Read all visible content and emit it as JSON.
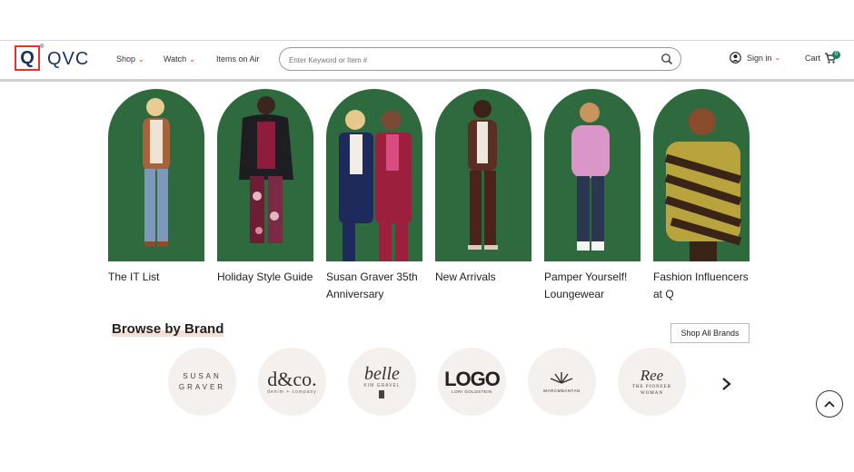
{
  "header": {
    "logo_mark": "Q",
    "logo_text": "QVC",
    "logo_tm": "®",
    "nav": [
      {
        "label": "Shop",
        "has_dropdown": true
      },
      {
        "label": "Watch",
        "has_dropdown": true
      },
      {
        "label": "Items on Air",
        "has_dropdown": false
      }
    ],
    "search": {
      "placeholder": "Enter Keyword or Item #",
      "icon": "search-icon"
    },
    "signin": {
      "label": "Sign in",
      "icon": "user-icon"
    },
    "cart": {
      "label": "Cart",
      "count": "0",
      "icon": "cart-icon"
    },
    "colors": {
      "brand": "#1b2f5e",
      "accent": "#e4332e"
    }
  },
  "categories": [
    {
      "label": "The IT List"
    },
    {
      "label": "Holiday Style Guide"
    },
    {
      "label": "Susan Graver 35th Anniversary"
    },
    {
      "label": "New Arrivals"
    },
    {
      "label": "Pamper Yourself! Loungewear"
    },
    {
      "label": "Fashion Influencers at Q"
    }
  ],
  "browse": {
    "title": "Browse by Brand",
    "shop_all": "Shop All Brands",
    "brands": [
      {
        "line1": "SUSAN",
        "line2": "GRAVER"
      },
      {
        "line1": "d&co.",
        "line2": "denim + company"
      },
      {
        "line1": "belle",
        "line2": "KIM GRAVEL"
      },
      {
        "line1": "LOGO",
        "line2": "LORI GOLDSTEIN"
      },
      {
        "line1": "MARCMBANTAN",
        "line2": ""
      },
      {
        "line1": "Ree",
        "line2": "THE PIONEER WOMAN"
      }
    ],
    "next_icon": "chevron-right-icon",
    "scroll_top_icon": "chevron-up-icon"
  }
}
